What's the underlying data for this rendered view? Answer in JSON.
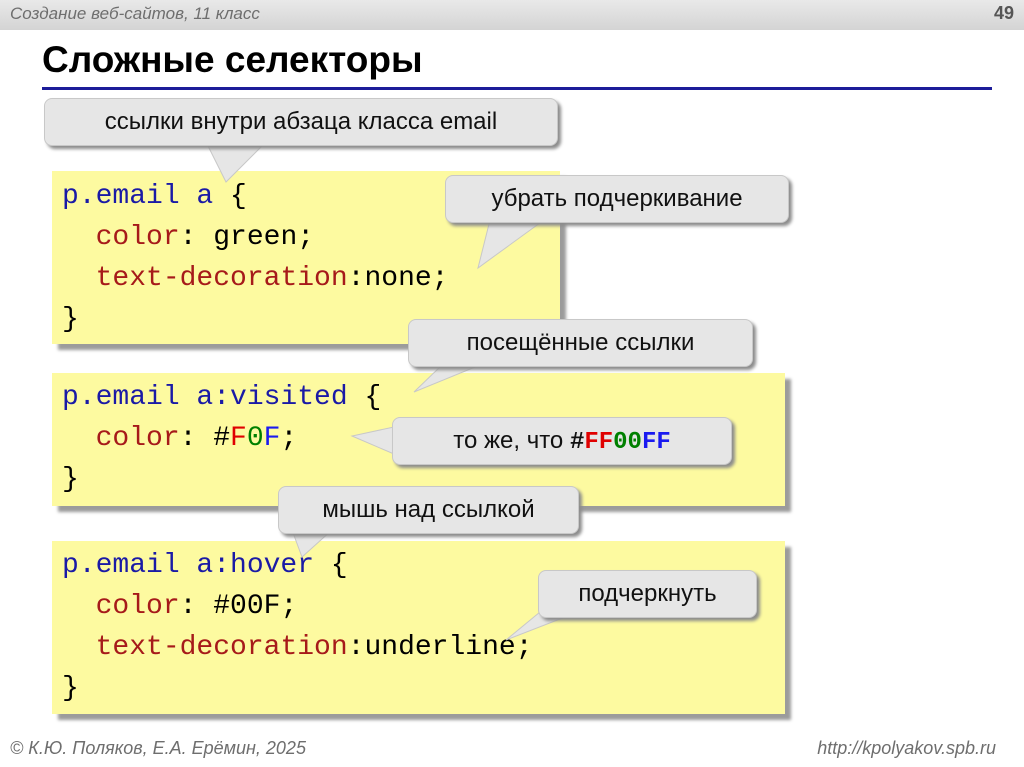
{
  "header": {
    "course": "Создание веб-сайтов, 11 класс",
    "page": "49"
  },
  "title": "Сложные селекторы",
  "block1": {
    "selector": "p.email a",
    "open": "{",
    "color_prop": "color",
    "color_val": "green;",
    "decor_prop": "text-decoration",
    "decor_val": "none;",
    "close": "}"
  },
  "block2": {
    "selector": "p.email a:visited",
    "open": "{",
    "color_prop": "color",
    "hash": "#",
    "f1": "F",
    "zero": "0",
    "f2": "F",
    "semi": ";",
    "close": "}"
  },
  "block3": {
    "selector": "p.email a:hover",
    "open": "{",
    "color_prop": "color",
    "color_val": "#00F;",
    "decor_prop": "text-decoration",
    "decor_val": "underline;",
    "close": "}"
  },
  "callouts": {
    "links_inside": "ссылки внутри абзаца класса email",
    "remove_underline": "убрать подчеркивание",
    "visited": "посещённые ссылки",
    "same_as_prefix": "то же, что ",
    "hex_hash": "#",
    "hex_ff1": "FF",
    "hex_00": "00",
    "hex_ff2": "FF",
    "hover": "мышь над ссылкой",
    "underline": "подчеркнуть"
  },
  "footer": {
    "authors": "© К.Ю. Поляков, Е.А. Ерёмин, 2025",
    "url": "http://kpolyakov.spb.ru"
  },
  "colors": {
    "code_bg": "#fdfaa0",
    "keyword": "#1a1aa6",
    "property": "#a61a1a",
    "title_rule": "#1c1c99",
    "callout_bg": "#e6e6e6"
  }
}
